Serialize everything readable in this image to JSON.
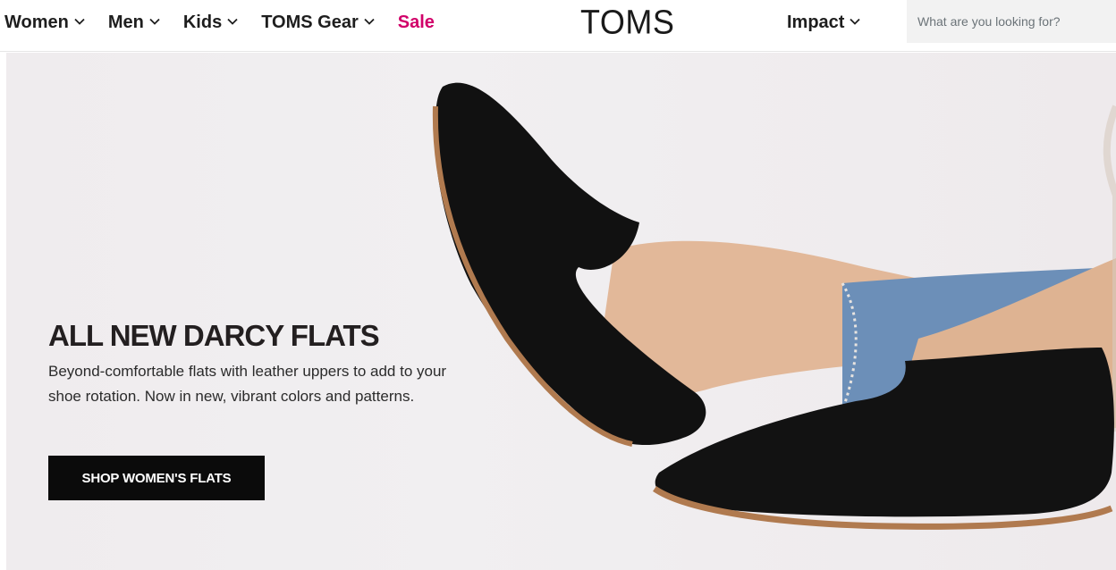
{
  "header": {
    "nav": [
      {
        "label": "Women",
        "has_dropdown": true
      },
      {
        "label": "Men",
        "has_dropdown": true
      },
      {
        "label": "Kids",
        "has_dropdown": true
      },
      {
        "label": "TOMS Gear",
        "has_dropdown": true
      },
      {
        "label": "Sale",
        "has_dropdown": false
      }
    ],
    "logo": "TOMS",
    "impact": {
      "label": "Impact",
      "has_dropdown": true
    },
    "search": {
      "placeholder": "What are you looking for?",
      "value": ""
    }
  },
  "hero": {
    "title": "ALL NEW DARCY FLATS",
    "description": "Beyond-comfortable flats with leather uppers to add to your shoe rotation. Now in new, vibrant colors and patterns.",
    "cta_label": "SHOP WOMEN'S FLATS"
  },
  "colors": {
    "sale": "#d10069",
    "text": "#1e1e1e",
    "button_bg": "#0b0b0b",
    "search_bg": "#f2f2f2",
    "hero_bg": "#efecee"
  },
  "icons": {
    "dropdown": "chevron-down-icon"
  }
}
